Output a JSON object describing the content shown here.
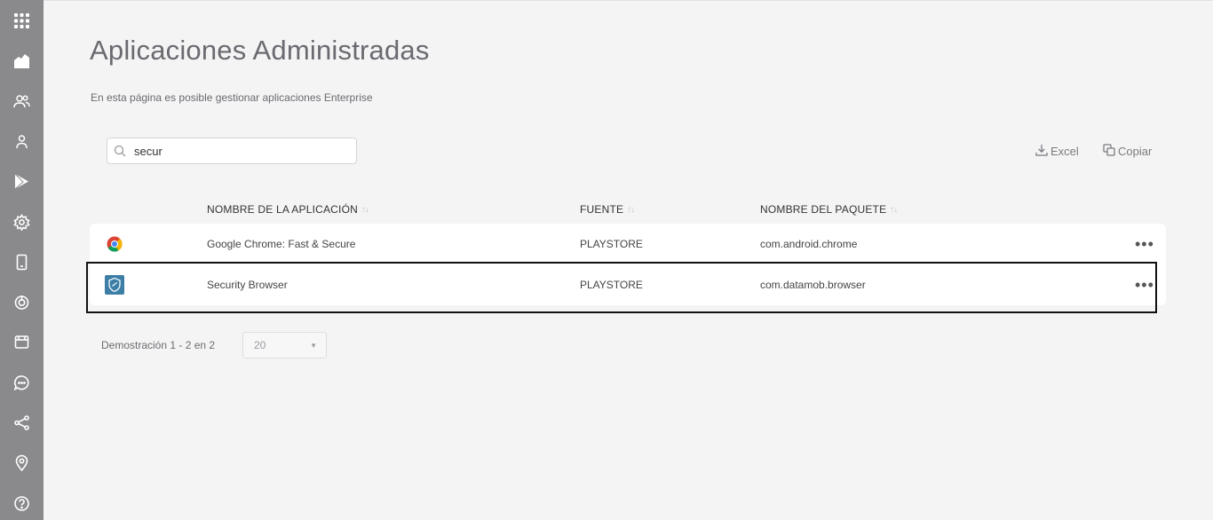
{
  "sidebar": {
    "items": [
      {
        "icon": "apps-grid-icon"
      },
      {
        "icon": "dashboard-home-icon"
      },
      {
        "icon": "users-group-icon"
      },
      {
        "icon": "user-icon"
      },
      {
        "icon": "play-store-icon"
      },
      {
        "icon": "settings-gear-icon"
      },
      {
        "icon": "device-icon"
      },
      {
        "icon": "power-icon"
      },
      {
        "icon": "calendar-icon"
      },
      {
        "icon": "chat-icon"
      },
      {
        "icon": "share-icon"
      },
      {
        "icon": "location-pin-icon"
      },
      {
        "icon": "help-icon"
      }
    ]
  },
  "page": {
    "title": "Aplicaciones Administradas",
    "subtitle": "En esta página es posible gestionar aplicaciones Enterprise"
  },
  "search": {
    "value": "secur",
    "placeholder": ""
  },
  "toolbar": {
    "excel_label": "Excel",
    "copy_label": "Copiar"
  },
  "table": {
    "columns": [
      "NOMBRE DE LA APLICACIÓN",
      "FUENTE",
      "NOMBRE DEL PAQUETE"
    ],
    "sort_glyph": "↑↓",
    "rows": [
      {
        "icon": "chrome-logo-icon",
        "name": "Google Chrome: Fast & Secure",
        "source": "PLAYSTORE",
        "package": "com.android.chrome",
        "more": "•••"
      },
      {
        "icon": "security-browser-logo-icon",
        "name": "Security Browser",
        "source": "PLAYSTORE",
        "package": "com.datamob.browser",
        "more": "•••"
      }
    ]
  },
  "pagination": {
    "text": "Demostración 1 - 2 en 2",
    "page_size": "20"
  },
  "colors": {
    "sidebar_bg": "#8a8a8d",
    "page_bg": "#f4f4f5",
    "highlight_border": "#111111"
  }
}
